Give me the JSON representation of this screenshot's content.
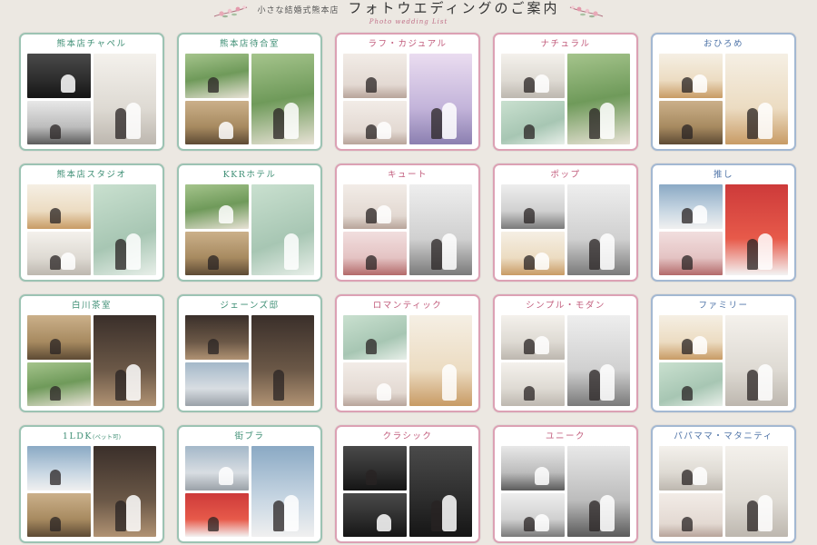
{
  "header": {
    "subtitle_small": "小さな結婚式熊本店",
    "title": "フォトウエディングのご案内",
    "subtitle_en": "Photo wedding List"
  },
  "cards": [
    {
      "title": "熊本店チャペル",
      "color": "green"
    },
    {
      "title": "熊本店待合室",
      "color": "green"
    },
    {
      "title": "ラフ・カジュアル",
      "color": "pink"
    },
    {
      "title": "ナチュラル",
      "color": "pink"
    },
    {
      "title": "おひろめ",
      "color": "blue"
    },
    {
      "title": "熊本店スタジオ",
      "color": "green"
    },
    {
      "title": "KKRホテル",
      "color": "green"
    },
    {
      "title": "キュート",
      "color": "pink"
    },
    {
      "title": "ポップ",
      "color": "pink"
    },
    {
      "title": "推し",
      "color": "blue"
    },
    {
      "title": "白川茶室",
      "color": "green"
    },
    {
      "title": "ジェーンズ邸",
      "color": "green"
    },
    {
      "title": "ロマンティック",
      "color": "pink"
    },
    {
      "title": "シンプル・モダン",
      "color": "pink"
    },
    {
      "title": "ファミリー",
      "color": "blue"
    },
    {
      "title": "1LDK",
      "title_small": "(ペット可)",
      "color": "green"
    },
    {
      "title": "街ブラ",
      "color": "green"
    },
    {
      "title": "クラシック",
      "color": "pink"
    },
    {
      "title": "ユニーク",
      "color": "pink"
    },
    {
      "title": "パパママ・マタニティ",
      "color": "blue"
    }
  ],
  "colors": {
    "green": "#3f8f75",
    "pink": "#c25c7c",
    "blue": "#4f74a8",
    "background": "#ece8e2"
  }
}
